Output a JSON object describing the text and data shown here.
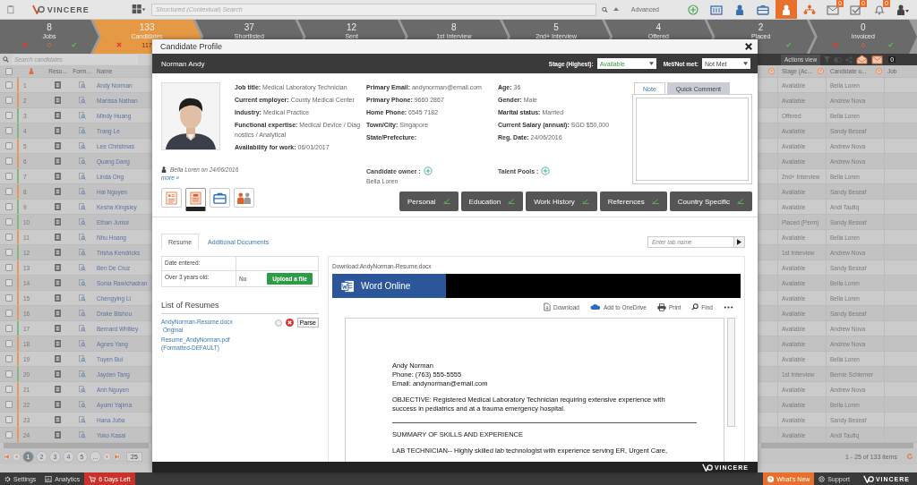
{
  "top_bar": {
    "logo": "VINCERE",
    "search": {
      "placeholder": "Structured (Contextual) Search"
    },
    "advanced": "Advanced",
    "nav_icons": [
      {
        "kind": "add",
        "selected": false
      },
      {
        "kind": "companies",
        "selected": false
      },
      {
        "kind": "contacts",
        "selected": false
      },
      {
        "kind": "jobs",
        "selected": false
      },
      {
        "kind": "candidates",
        "selected": true
      },
      {
        "kind": "org",
        "selected": false
      },
      {
        "kind": "mail",
        "selected": false,
        "badge": "0"
      },
      {
        "kind": "tasks",
        "selected": false,
        "badge": "0"
      },
      {
        "kind": "bell",
        "selected": false,
        "badge": "0"
      },
      {
        "kind": "user",
        "selected": false
      }
    ]
  },
  "pipeline": [
    {
      "count": "8",
      "label": "Jobs",
      "selected": false,
      "reject_icon": true,
      "sub": "0",
      "check_icon": true
    },
    {
      "count": "133",
      "label": "Candidates",
      "selected": true,
      "reject_icon": true,
      "sub": "117"
    },
    {
      "count": "37",
      "label": "Shortlisted",
      "selected": false
    },
    {
      "count": "12",
      "label": "Sent",
      "selected": false
    },
    {
      "count": "8",
      "label": "1st Interview",
      "selected": false
    },
    {
      "count": "5",
      "label": "2nd+ Interview",
      "selected": false
    },
    {
      "count": "4",
      "label": "Offered",
      "selected": false
    },
    {
      "count": "2",
      "label": "Placed",
      "selected": false,
      "check_icon": true
    },
    {
      "count": "0",
      "label": "Invoiced",
      "selected": false,
      "reject_icon": true,
      "sub": "0",
      "check_icon": true
    }
  ],
  "left_table": {
    "all_checked": false,
    "search": {
      "placeholder": "Search candidates"
    },
    "columns": [
      "Resu...",
      "Form...",
      "Name"
    ],
    "rows": [
      {
        "num": "1",
        "color": "#e8975a",
        "name": "Andy Norman",
        "checked": false
      },
      {
        "num": "2",
        "color": "#e8975a",
        "name": "Marissa Nathan",
        "checked": false
      },
      {
        "num": "3",
        "color": "#7fb77f",
        "name": "Mindy Huang",
        "checked": false
      },
      {
        "num": "4",
        "color": "#7fb77f",
        "name": "Trang Le",
        "checked": false
      },
      {
        "num": "5",
        "color": "#e8975a",
        "name": "Lee Christmas",
        "checked": false
      },
      {
        "num": "6",
        "color": "#e8975a",
        "name": "Quang Dang",
        "checked": false
      },
      {
        "num": "7",
        "color": "#7fb77f",
        "name": "Linda Ong",
        "checked": false
      },
      {
        "num": "8",
        "color": "#e8975a",
        "name": "Hai Nguyen",
        "checked": false
      },
      {
        "num": "9",
        "color": "#7fb77f",
        "name": "Kesha Kingsley",
        "checked": false
      },
      {
        "num": "10",
        "color": "#7fb77f",
        "name": "Ethan Junior",
        "checked": false
      },
      {
        "num": "11",
        "color": "#e8975a",
        "name": "Nhu Hoang",
        "checked": false
      },
      {
        "num": "12",
        "color": "#7fb77f",
        "name": "Trisha Kendricks",
        "checked": false
      },
      {
        "num": "13",
        "color": "#e8975a",
        "name": "Ben De Cruz",
        "checked": false
      },
      {
        "num": "14",
        "color": "#e8975a",
        "name": "Sonia Rawichadran",
        "checked": false
      },
      {
        "num": "15",
        "color": "#e8975a",
        "name": "Chengying Li",
        "checked": false
      },
      {
        "num": "16",
        "color": "#e8975a",
        "name": "Drake Bishou",
        "checked": false
      },
      {
        "num": "17",
        "color": "#7fb77f",
        "name": "Bernard Whitley",
        "checked": false
      },
      {
        "num": "18",
        "color": "#e8975a",
        "name": "Agnes Yang",
        "checked": false
      },
      {
        "num": "19",
        "color": "#e8975a",
        "name": "Tuyen Bui",
        "checked": false
      },
      {
        "num": "20",
        "color": "#7fb77f",
        "name": "Jayden Tang",
        "checked": false
      },
      {
        "num": "21",
        "color": "#e8975a",
        "name": "Anh Nguyen",
        "checked": false
      },
      {
        "num": "22",
        "color": "#e8975a",
        "name": "Ayumi Yajima",
        "checked": false
      },
      {
        "num": "23",
        "color": "#e8975a",
        "name": "Hana Juba",
        "checked": false
      },
      {
        "num": "24",
        "color": "#e8975a",
        "name": "Yoko Kasai",
        "checked": false
      }
    ],
    "pages": [
      {
        "label": "1",
        "selected": true
      },
      {
        "label": "2",
        "selected": false
      },
      {
        "label": "3",
        "selected": false
      },
      {
        "label": "4",
        "selected": false
      },
      {
        "label": "5",
        "selected": false
      },
      {
        "label": "...",
        "selected": false
      }
    ],
    "page_size": "25"
  },
  "right_table": {
    "actions_view": "Actions view",
    "badge": "0",
    "columns": [
      "Stage (Ac...",
      "Candidate o...",
      "Job"
    ],
    "rows": [
      {
        "stage": "Available",
        "owner": "Bella Loren"
      },
      {
        "stage": "Available",
        "owner": "Andrew Nova"
      },
      {
        "stage": "Offered",
        "owner": "Bella Loren"
      },
      {
        "stage": "Available",
        "owner": "Sandy Beseaf"
      },
      {
        "stage": "Available",
        "owner": "Andrew Nova"
      },
      {
        "stage": "Available",
        "owner": "Andrew Nova"
      },
      {
        "stage": "2nd+ Interview",
        "owner": "Bella Loren"
      },
      {
        "stage": "Available",
        "owner": "Sandy Beseaf"
      },
      {
        "stage": "Available",
        "owner": "Andi Taufiq"
      },
      {
        "stage": "Placed (Perm)",
        "owner": "Sandy Beseaf"
      },
      {
        "stage": "Available",
        "owner": "Bella Loren"
      },
      {
        "stage": "1st Interview",
        "owner": "Andrew Nova"
      },
      {
        "stage": "Available",
        "owner": "Sandy Beseaf"
      },
      {
        "stage": "Available",
        "owner": "Bella Loren"
      },
      {
        "stage": "Available",
        "owner": "Bella Loren"
      },
      {
        "stage": "Available",
        "owner": "Sandy Beseaf"
      },
      {
        "stage": "Available",
        "owner": "Andrew Nova"
      },
      {
        "stage": "Available",
        "owner": "Andrew Nova"
      },
      {
        "stage": "Available",
        "owner": "Bella Loren"
      },
      {
        "stage": "1st Interview",
        "owner": "Bernie Schiemer"
      },
      {
        "stage": "Available",
        "owner": "Andrew Nova"
      },
      {
        "stage": "Available",
        "owner": "Bella Loren"
      },
      {
        "stage": "Available",
        "owner": "Sandy Beseaf"
      },
      {
        "stage": "Available",
        "owner": "Andi Taufiq"
      }
    ],
    "items": "1 - 25 of 133 items"
  },
  "modal": {
    "title": "Candidate Profile",
    "name": "Norman Andy",
    "stage_label": "Stage (Highest):",
    "stage": "Available",
    "met_label": "Met/Not met:",
    "met": "Not Met",
    "field_columns": [
      [
        "**Job title:** Medical Laboratory Technician",
        "**Current employer:** County Medical Center",
        "**Industry:** Medical Practice",
        "**Functional expertise:** Medical Device / Diagnostics / Analytical",
        "**Availability for work:** 06/01/2017"
      ],
      [
        "**Primary Email:** andynorman@email.com",
        "**Primary Phone:** 9660 2867",
        "**Home Phone:** 6545 7182",
        "**Town/City:** Singapore",
        "**State/Prefecture:**"
      ],
      [
        "**Age:** 36",
        "**Gender:** Male",
        "**Marital status:**  Married",
        "**Current Salary (annual):** SGD $50,000",
        "**Reg. Date:** 24/06/2016"
      ]
    ],
    "created": "Bella Loren on 24/06/2016",
    "more": "more »",
    "owner_label": "Candidate owner :",
    "owner": "Bella Loren",
    "talent_label": "Talent Pools :",
    "note_tabs": [
      {
        "label": "Note",
        "selected": true
      },
      {
        "label": "Quick Comment",
        "selected": false
      }
    ],
    "icon_tabs": [
      {
        "kind": "resume",
        "selected": false
      },
      {
        "kind": "document",
        "selected": true
      },
      {
        "kind": "briefcase",
        "selected": false
      },
      {
        "kind": "people",
        "selected": false
      }
    ],
    "sections": [
      "Personal",
      "Education",
      "Work History",
      "References",
      "Country Specific"
    ],
    "doc_tabs": [
      {
        "label": "Resume",
        "selected": true
      },
      {
        "label": "Additional Documents",
        "selected": false
      }
    ],
    "tab_name": {
      "placeholder": "Enter tab name"
    },
    "info": [
      {
        "label": "Date entered:"
      },
      {
        "label": "Over 3 years old:",
        "value": "No",
        "upload": "Upload a file"
      }
    ],
    "list_title": "List of Resumes",
    "resumes": [
      {
        "name": "AndyNorman-Resume.docx",
        "note": "Original",
        "parse": "Parse",
        "selected": false
      },
      {
        "name": "Resume_AndyNorman.pdf (Formatted-DEFAULT)"
      }
    ],
    "download": "Download:AndyNorman-Resume.docx",
    "word": "Word Online",
    "toolbar": [
      {
        "kind": "download",
        "label": "Download"
      },
      {
        "kind": "onedrive",
        "label": "Add to OneDrive"
      },
      {
        "kind": "print",
        "label": "Print"
      },
      {
        "kind": "find",
        "label": "Find"
      }
    ],
    "doc": [
      {
        "kind": "lines",
        "lines": [
          "Andy Norman",
          "Phone: (763) 555-5555",
          "Email:  andynorman@email.com"
        ]
      },
      {
        "kind": "para",
        "text": "OBJECTIVE:  Registered Medical Laboratory Technician requiring extensive experience with success in pediatrics and at a trauma emergency hospital."
      },
      {
        "kind": "rule"
      },
      {
        "kind": "para",
        "text": "SUMMARY  OF SKILLS AND EXPERIENCE"
      },
      {
        "kind": "para",
        "text": "LAB TECHNICIAN--  Highly skilled lab technologist with experience serving ER, Urgent Care,"
      }
    ],
    "footer_logo": "VINCERE"
  },
  "bottom_bar": {
    "left": [
      {
        "kind": "settings",
        "label": "Settings"
      },
      {
        "kind": "analytics",
        "label": "Analytics"
      },
      {
        "kind": "trial",
        "label": "6 Days Left"
      }
    ],
    "right": [
      {
        "kind": "news",
        "label": "What's New"
      },
      {
        "kind": "support",
        "label": "Support"
      }
    ],
    "logo": "VINCERE"
  }
}
